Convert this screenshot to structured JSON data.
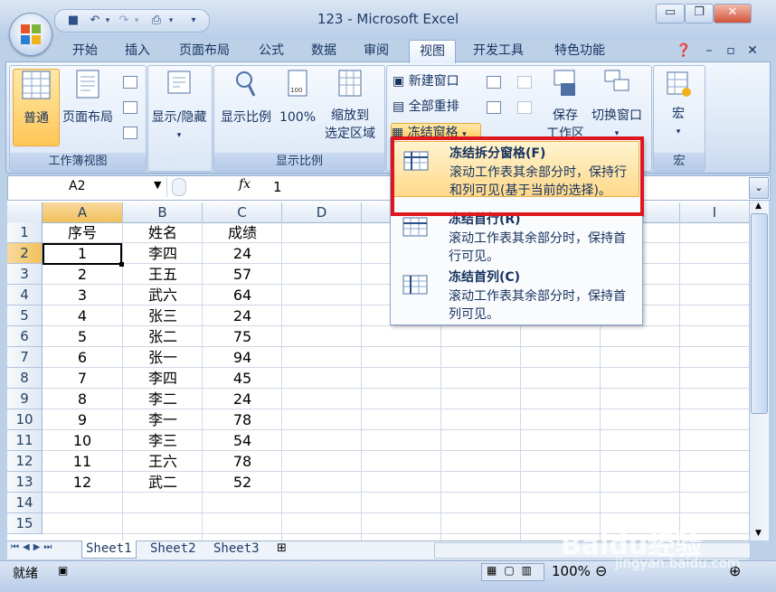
{
  "window": {
    "title": "123 - Microsoft Excel",
    "minimize": "▭",
    "restore": "❐",
    "close": "✕"
  },
  "qat": {
    "icons": [
      "save-icon",
      "undo-icon",
      "redo-icon",
      "print-preview-icon"
    ]
  },
  "tabs": [
    "开始",
    "插入",
    "页面布局",
    "公式",
    "数据",
    "审阅",
    "视图",
    "开发工具",
    "特色功能"
  ],
  "active_tab": "视图",
  "ribbon": {
    "workbook_views": {
      "label": "工作簿视图",
      "normal": "普通",
      "page_layout": "页面布局"
    },
    "show_hide": {
      "label": "显示/隐藏"
    },
    "zoom": {
      "label": "显示比例",
      "zoom": "显示比例",
      "hundred": "100%",
      "to_selection_1": "缩放到",
      "to_selection_2": "选定区域"
    },
    "window": {
      "new_window": "新建窗口",
      "arrange_all": "全部重排",
      "freeze_panes": "冻结窗格",
      "save_1": "保存",
      "save_2": "工作区",
      "switch": "切换窗口"
    },
    "macros": {
      "label": "宏",
      "macro": "宏"
    }
  },
  "formula_bar": {
    "name_box": "A2",
    "fx": "fx",
    "value": "1"
  },
  "columns": [
    "A",
    "B",
    "C",
    "D",
    "E",
    "F",
    "G",
    "H",
    "I"
  ],
  "rows": [
    "1",
    "2",
    "3",
    "4",
    "5",
    "6",
    "7",
    "8",
    "9",
    "10",
    "11",
    "12",
    "13",
    "14",
    "15"
  ],
  "table": {
    "header": [
      "序号",
      "姓名",
      "成绩"
    ],
    "data": [
      [
        "1",
        "李四",
        "24"
      ],
      [
        "2",
        "王五",
        "57"
      ],
      [
        "3",
        "武六",
        "64"
      ],
      [
        "4",
        "张三",
        "24"
      ],
      [
        "5",
        "张二",
        "75"
      ],
      [
        "6",
        "张一",
        "94"
      ],
      [
        "7",
        "李四",
        "45"
      ],
      [
        "8",
        "李二",
        "24"
      ],
      [
        "9",
        "李一",
        "78"
      ],
      [
        "10",
        "李三",
        "54"
      ],
      [
        "11",
        "王六",
        "78"
      ],
      [
        "12",
        "武二",
        "52"
      ]
    ]
  },
  "sheets": [
    "Sheet1",
    "Sheet2",
    "Sheet3"
  ],
  "status": {
    "ready": "就绪",
    "zoom": "100%"
  },
  "freeze_menu": [
    {
      "title": "冻结拆分窗格(F)",
      "desc": "滚动工作表其余部分时，保持行和列可见(基于当前的选择)。"
    },
    {
      "title": "冻结首行(R)",
      "desc": "滚动工作表其余部分时，保持首行可见。"
    },
    {
      "title": "冻结首列(C)",
      "desc": "滚动工作表其余部分时，保持首列可见。"
    }
  ],
  "watermark": {
    "brand": "Baidu经验",
    "url": "jingyan.baidu.com"
  },
  "colors": {
    "accent": "#ffc656",
    "highlight_box": "#e0161e"
  }
}
